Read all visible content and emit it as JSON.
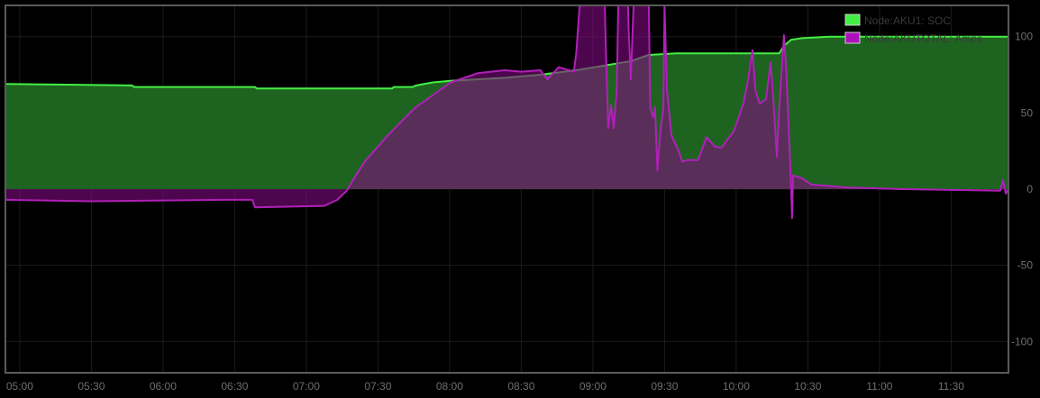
{
  "chart_data": {
    "type": "area",
    "title": "",
    "xlabel": "",
    "ylabel": "",
    "x_unit": "minutes after 05:00",
    "xlim": [
      -6,
      414
    ],
    "ylim": [
      -120.5,
      120.5
    ],
    "grid": true,
    "legend_position": "top-right",
    "x_ticks": [
      {
        "value": 0,
        "label": "05:00"
      },
      {
        "value": 30,
        "label": "05:30"
      },
      {
        "value": 60,
        "label": "06:00"
      },
      {
        "value": 90,
        "label": "06:30"
      },
      {
        "value": 120,
        "label": "07:00"
      },
      {
        "value": 150,
        "label": "07:30"
      },
      {
        "value": 180,
        "label": "08:00"
      },
      {
        "value": 210,
        "label": "08:30"
      },
      {
        "value": 240,
        "label": "09:00"
      },
      {
        "value": 270,
        "label": "09:30"
      },
      {
        "value": 300,
        "label": "10:00"
      },
      {
        "value": 330,
        "label": "10:30"
      },
      {
        "value": 360,
        "label": "11:00"
      },
      {
        "value": 390,
        "label": "11:30"
      }
    ],
    "y_ticks": [
      {
        "value": 100,
        "label": "100"
      },
      {
        "value": 50,
        "label": "50"
      },
      {
        "value": 0,
        "label": "0"
      },
      {
        "value": -50,
        "label": "-50"
      },
      {
        "value": -100,
        "label": "-100"
      }
    ],
    "series": [
      {
        "name": "Node:AKU1: SOC",
        "line_color": "#44ee44",
        "fill_color": "#1e6420",
        "points": [
          [
            -6,
            69
          ],
          [
            47,
            68
          ],
          [
            48,
            67
          ],
          [
            98.5,
            67
          ],
          [
            99.3,
            66
          ],
          [
            156,
            66
          ],
          [
            156.6,
            67
          ],
          [
            164.5,
            67
          ],
          [
            166,
            68
          ],
          [
            173,
            70
          ],
          [
            180.4,
            71
          ],
          [
            203,
            73
          ],
          [
            218,
            75
          ],
          [
            233,
            78
          ],
          [
            240.8,
            80
          ],
          [
            256,
            84
          ],
          [
            263.4,
            88
          ],
          [
            274.8,
            89
          ],
          [
            318,
            89
          ],
          [
            320,
            94
          ],
          [
            323,
            98
          ],
          [
            327.6,
            99
          ],
          [
            339,
            100
          ],
          [
            414,
            100
          ]
        ]
      },
      {
        "name": "Node:AKUTOTAL: Amps",
        "line_color": "#b020b8",
        "fill_color": "#800a80",
        "points": [
          [
            -6,
            -7
          ],
          [
            29.4,
            -8
          ],
          [
            86,
            -7
          ],
          [
            97.4,
            -7
          ],
          [
            98.5,
            -12
          ],
          [
            127.6,
            -11
          ],
          [
            133,
            -7
          ],
          [
            137,
            -1
          ],
          [
            139.6,
            6
          ],
          [
            144.5,
            18
          ],
          [
            154,
            35
          ],
          [
            165.3,
            53
          ],
          [
            180.4,
            70
          ],
          [
            191.7,
            76
          ],
          [
            203,
            78
          ],
          [
            210,
            77
          ],
          [
            218,
            78
          ],
          [
            221,
            72
          ],
          [
            225.7,
            80
          ],
          [
            232,
            77
          ],
          [
            233,
            89
          ],
          [
            234.4,
            120
          ],
          [
            236,
            121
          ],
          [
            239,
            121
          ],
          [
            245,
            121
          ],
          [
            245.6,
            83
          ],
          [
            246.4,
            40
          ],
          [
            247.6,
            55
          ],
          [
            248.7,
            40
          ],
          [
            250,
            65
          ],
          [
            250.6,
            121
          ],
          [
            254.7,
            121
          ],
          [
            255,
            104
          ],
          [
            255.9,
            72
          ],
          [
            257,
            121
          ],
          [
            263.4,
            121
          ],
          [
            264,
            53
          ],
          [
            265.3,
            47
          ],
          [
            266,
            54
          ],
          [
            267,
            12
          ],
          [
            268.3,
            38
          ],
          [
            269.5,
            53
          ],
          [
            270,
            121
          ],
          [
            271,
            65
          ],
          [
            272.9,
            35
          ],
          [
            275.9,
            25
          ],
          [
            277.4,
            18
          ],
          [
            279.6,
            19
          ],
          [
            284,
            19
          ],
          [
            287.6,
            34
          ],
          [
            291,
            28
          ],
          [
            293.7,
            27
          ],
          [
            299,
            38
          ],
          [
            303,
            56
          ],
          [
            304.9,
            71
          ],
          [
            306.8,
            91
          ],
          [
            308,
            65
          ],
          [
            309.8,
            56
          ],
          [
            312.5,
            59
          ],
          [
            314.4,
            83
          ],
          [
            315.5,
            60
          ],
          [
            317,
            21
          ],
          [
            318,
            52
          ],
          [
            320,
            101
          ],
          [
            321,
            77
          ],
          [
            322.7,
            12
          ],
          [
            323.4,
            -19
          ],
          [
            323.8,
            9
          ],
          [
            327.6,
            7
          ],
          [
            331.4,
            3
          ],
          [
            346.5,
            1
          ],
          [
            369,
            0
          ],
          [
            410.6,
            -1
          ],
          [
            411.7,
            6
          ],
          [
            412.9,
            -3
          ],
          [
            414,
            0
          ]
        ]
      }
    ]
  }
}
